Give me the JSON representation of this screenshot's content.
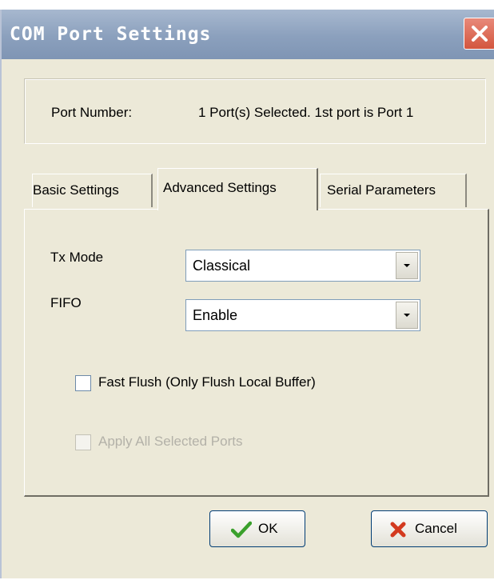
{
  "window": {
    "title": "COM Port Settings"
  },
  "port": {
    "label": "Port Number:",
    "value": "1 Port(s) Selected. 1st port is Port 1"
  },
  "tabs": [
    {
      "label": "Basic Settings",
      "active": false
    },
    {
      "label": "Advanced Settings",
      "active": true
    },
    {
      "label": "Serial Parameters",
      "active": false
    }
  ],
  "advanced": {
    "tx_mode": {
      "label": "Tx Mode",
      "value": "Classical"
    },
    "fifo": {
      "label": "FIFO",
      "value": "Enable"
    },
    "fast_flush": {
      "label": "Fast Flush (Only Flush Local Buffer)",
      "checked": false,
      "enabled": true
    },
    "apply_all": {
      "label": "Apply All Selected Ports",
      "checked": false,
      "enabled": false
    }
  },
  "buttons": {
    "ok": {
      "label": "OK",
      "icon": "check-icon",
      "icon_color": "#3aa02c"
    },
    "cancel": {
      "label": "Cancel",
      "icon": "x-icon",
      "icon_color": "#d33a1f"
    }
  }
}
